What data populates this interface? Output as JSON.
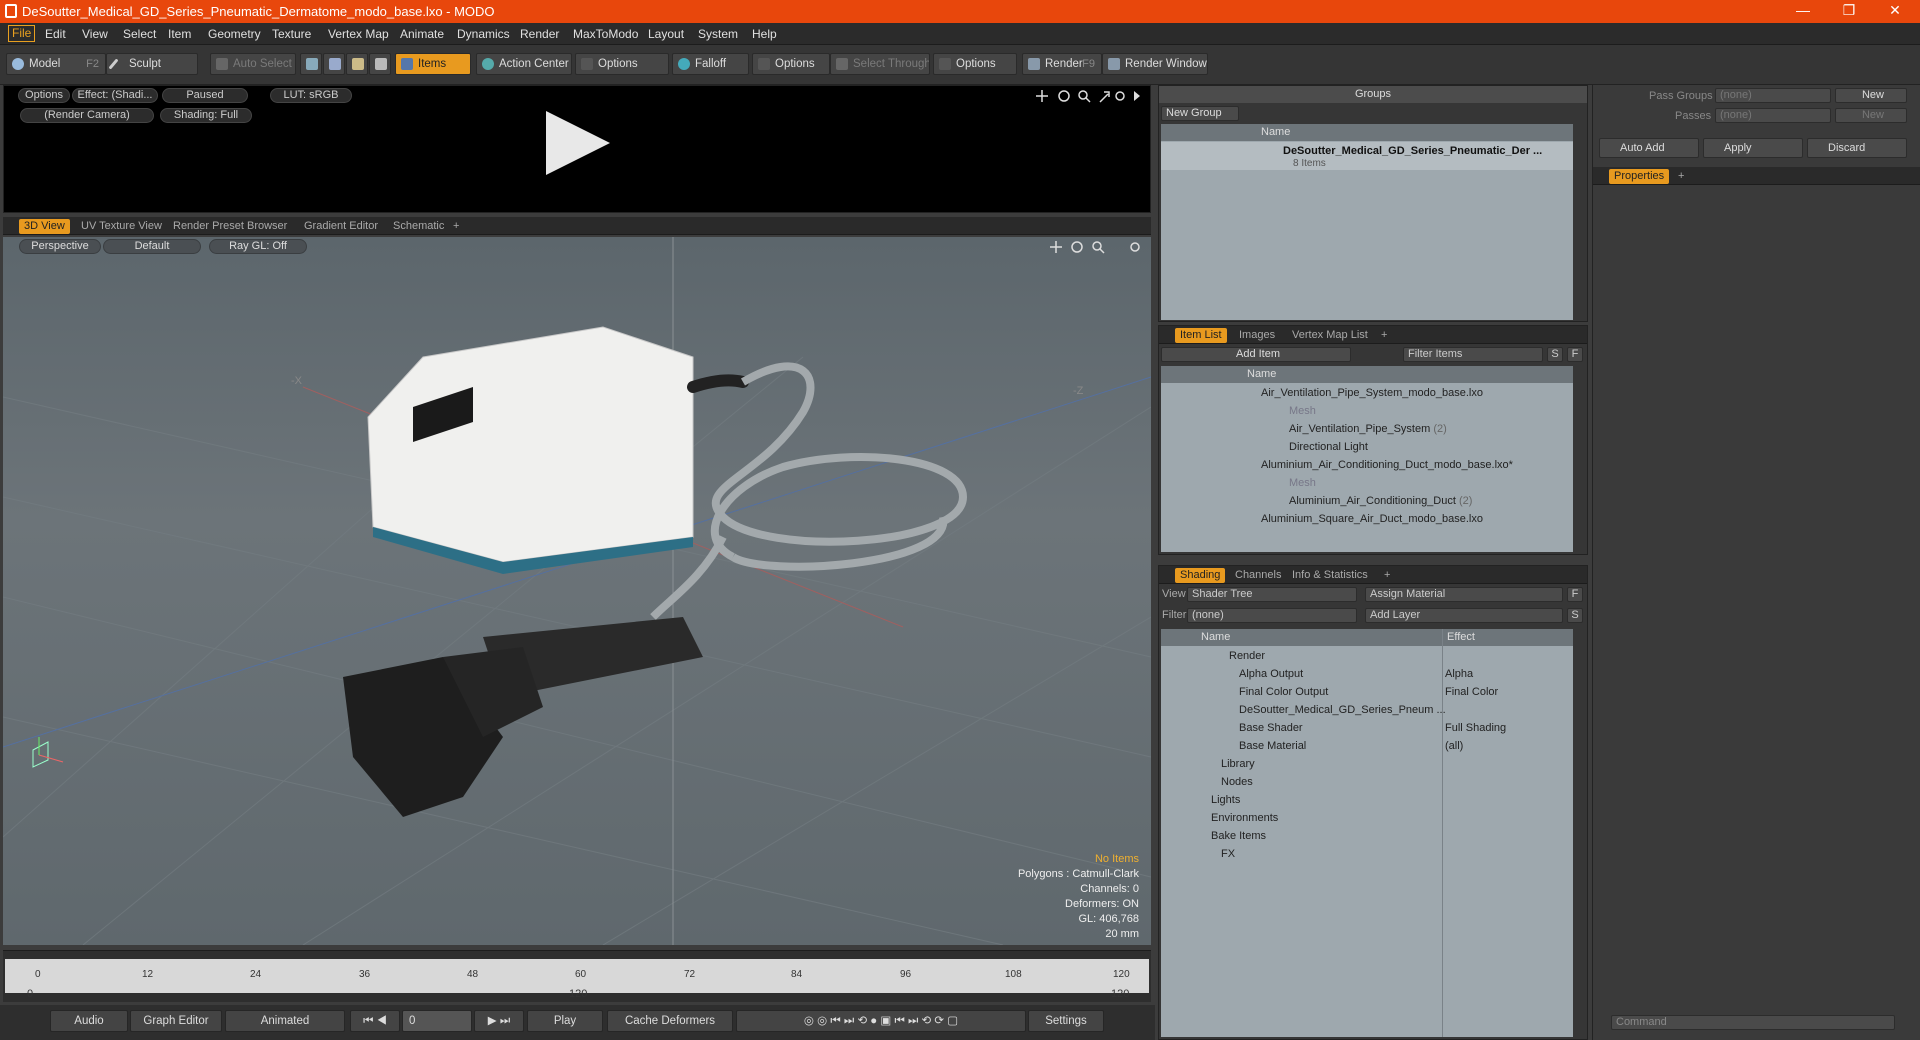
{
  "window": {
    "title": "DeSoutter_Medical_GD_Series_Pneumatic_Dermatome_modo_base.lxo - MODO",
    "minimize": "—",
    "restore": "❐",
    "close": "✕"
  },
  "menu": [
    "File",
    "Edit",
    "View",
    "Select",
    "Item",
    "Geometry",
    "Texture",
    "Vertex Map",
    "Animate",
    "Dynamics",
    "Render",
    "MaxToModo",
    "Layout",
    "System",
    "Help"
  ],
  "toolbar": {
    "model": "Model",
    "model_key": "F2",
    "sculpt": "Sculpt",
    "auto_select": "Auto Select",
    "items": "Items",
    "action_center": "Action Center",
    "options": "Options",
    "falloff": "Falloff",
    "options2": "Options",
    "select_through": "Select Through",
    "options3": "Options",
    "render": "Render",
    "render_key": "F9",
    "render_window": "Render Window"
  },
  "preview": {
    "options": "Options",
    "effect": "Effect: (Shadi...",
    "paused": "Paused",
    "lut": "LUT: sRGB",
    "camera": "(Render Camera)",
    "shading": "Shading: Full"
  },
  "viewtabs": [
    "3D View",
    "UV Texture View",
    "Render Preset Browser",
    "Gradient Editor",
    "Schematic",
    "+"
  ],
  "viewport": {
    "perspective": "Perspective",
    "default": "Default",
    "raygl": "Ray GL: Off",
    "axis_x": "-X",
    "axis_z": "-Z",
    "stats": {
      "no_items": "No Items",
      "polygons": "Polygons : Catmull-Clark",
      "channels": "Channels: 0",
      "deformers": "Deformers: ON",
      "gl": "GL: 406,768",
      "size": "20 mm"
    }
  },
  "timeline": {
    "ticks": [
      "0",
      "12",
      "24",
      "36",
      "48",
      "60",
      "72",
      "84",
      "96",
      "108",
      "120"
    ],
    "start": "0",
    "mid": "120",
    "end": "120"
  },
  "transport": {
    "audio": "Audio",
    "graph_editor": "Graph Editor",
    "animated": "Animated",
    "frame": "0",
    "play": "Play",
    "cache": "Cache Deformers",
    "settings": "Settings"
  },
  "groups": {
    "title": "Groups",
    "new_group": "New Group",
    "col_name": "Name",
    "item": "DeSoutter_Medical_GD_Series_Pneumatic_Der ...",
    "item_sub": "8 Items"
  },
  "itemlist": {
    "tabs": [
      "Item List",
      "Images",
      "Vertex Map List",
      "+"
    ],
    "add_item": "Add Item",
    "filter": "Filter Items",
    "s": "S",
    "f": "F",
    "col_name": "Name",
    "rows": [
      {
        "label": "Air_Ventilation_Pipe_System_modo_base.lxo",
        "indent": 0
      },
      {
        "label": "Mesh",
        "indent": 2,
        "dim": true
      },
      {
        "label": "Air_Ventilation_Pipe_System",
        "count": "(2)",
        "indent": 1
      },
      {
        "label": "Directional Light",
        "indent": 1
      },
      {
        "label": "Aluminium_Air_Conditioning_Duct_modo_base.lxo*",
        "indent": 0
      },
      {
        "label": "Mesh",
        "indent": 2,
        "dim": true
      },
      {
        "label": "Aluminium_Air_Conditioning_Duct",
        "count": "(2)",
        "indent": 1
      },
      {
        "label": "Aluminium_Square_Air_Duct_modo_base.lxo",
        "indent": 0
      }
    ]
  },
  "shading": {
    "tabs": [
      "Shading",
      "Channels",
      "Info & Statistics",
      "+"
    ],
    "view_label": "View",
    "view_val": "Shader Tree",
    "assign": "Assign Material",
    "f": "F",
    "filter_label": "Filter",
    "filter_val": "(none)",
    "add_layer": "Add Layer",
    "s": "S",
    "col_name": "Name",
    "col_effect": "Effect",
    "rows": [
      {
        "label": "Render",
        "effect": ""
      },
      {
        "label": "Alpha Output",
        "effect": "Alpha"
      },
      {
        "label": "Final Color Output",
        "effect": "Final Color"
      },
      {
        "label": "DeSoutter_Medical_GD_Series_Pneum ...",
        "effect": ""
      },
      {
        "label": "Base Shader",
        "effect": "Full Shading"
      },
      {
        "label": "Base Material",
        "effect": "(all)"
      },
      {
        "label": "Library",
        "effect": ""
      },
      {
        "label": "Nodes",
        "effect": ""
      },
      {
        "label": "Lights",
        "effect": ""
      },
      {
        "label": "Environments",
        "effect": ""
      },
      {
        "label": "Bake Items",
        "effect": ""
      },
      {
        "label": "FX",
        "effect": ""
      }
    ]
  },
  "right": {
    "pass_groups": "Pass Groups",
    "passes": "Passes",
    "none": "(none)",
    "none2": "(none)",
    "new": "New",
    "new2": "New",
    "auto_add": "Auto Add",
    "apply": "Apply",
    "discard": "Discard",
    "properties": "Properties",
    "plus": "+",
    "command": "Command"
  }
}
